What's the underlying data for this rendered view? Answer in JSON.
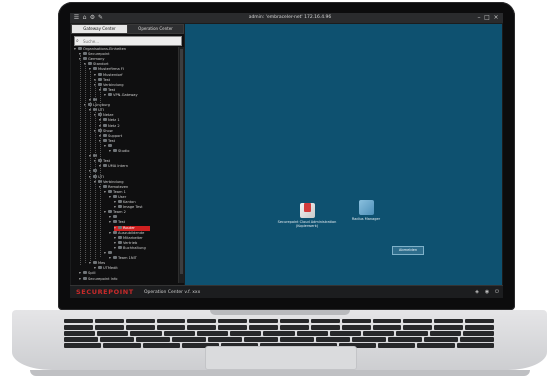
{
  "window": {
    "title": "admin: 'embraceler-net' 172.16.4.96"
  },
  "sidebar": {
    "tabs": [
      {
        "label": "Gateway Center",
        "active": true
      },
      {
        "label": "Operation Center",
        "active": false
      }
    ],
    "filter_placeholder": "Suche..."
  },
  "tree": [
    {
      "label": "Organisations-Einheiten",
      "depth": 0
    },
    {
      "label": "Securepoint",
      "depth": 1
    },
    {
      "label": "Germany",
      "depth": 1
    },
    {
      "label": "Standort",
      "depth": 2
    },
    {
      "label": "Musterfirma FI",
      "depth": 3
    },
    {
      "label": "Musterdorf",
      "depth": 4
    },
    {
      "label": "Test",
      "depth": 4
    },
    {
      "label": "Verbindung",
      "depth": 4
    },
    {
      "label": "Test",
      "depth": 5
    },
    {
      "label": "VPN-Gateway",
      "depth": 6
    },
    {
      "label": "",
      "depth": 3
    },
    {
      "label": "Lüneburg",
      "depth": 2
    },
    {
      "label": "UTI",
      "depth": 3
    },
    {
      "label": "Netze",
      "depth": 4
    },
    {
      "label": "Netz 1",
      "depth": 5
    },
    {
      "label": "Netz 2",
      "depth": 5
    },
    {
      "label": "Show",
      "depth": 4
    },
    {
      "label": "Support",
      "depth": 5
    },
    {
      "label": "Test",
      "depth": 5
    },
    {
      "label": "",
      "depth": 6
    },
    {
      "label": "Studio",
      "depth": 7
    },
    {
      "label": "",
      "depth": 3
    },
    {
      "label": "Test",
      "depth": 4
    },
    {
      "label": "UMA Intern",
      "depth": 5
    },
    {
      "label": "",
      "depth": 3
    },
    {
      "label": "UTI",
      "depth": 3
    },
    {
      "label": "Verbindung",
      "depth": 4
    },
    {
      "label": "Remotezen",
      "depth": 5
    },
    {
      "label": "Team 1",
      "depth": 6
    },
    {
      "label": "User",
      "depth": 7
    },
    {
      "label": "Kanton",
      "depth": 8
    },
    {
      "label": "Image Test",
      "depth": 8
    },
    {
      "label": "Team 2",
      "depth": 6
    },
    {
      "label": "",
      "depth": 7
    },
    {
      "label": "Test",
      "depth": 7
    },
    {
      "label": "Router",
      "depth": 8,
      "selected": true
    },
    {
      "label": "Auszubildende",
      "depth": 7
    },
    {
      "label": "Mitarbeiter",
      "depth": 8
    },
    {
      "label": "Vertrieb",
      "depth": 8
    },
    {
      "label": "Buchhaltung",
      "depth": 8
    },
    {
      "label": "",
      "depth": 6
    },
    {
      "label": "Team 1NIT",
      "depth": 7
    },
    {
      "label": "Mes",
      "depth": 3
    },
    {
      "label": "UTMedit",
      "depth": 4
    },
    {
      "label": "Spill",
      "depth": 1
    },
    {
      "label": "Securepoint Info",
      "depth": 1
    }
  ],
  "desktop": {
    "icons": [
      {
        "label": "Securepoint Cloud Administration (Kopierwerk)",
        "color": "#c9c9c9"
      },
      {
        "label": "Radius Manager",
        "color": "#4d8fb8"
      }
    ],
    "logout_label": "Abmelden"
  },
  "footer": {
    "brand": "SECUREPOINT",
    "subtitle": "Operation Center v.f. xxx"
  },
  "colors": {
    "desktop": "#0e5170",
    "brand": "#c82a2a",
    "selection": "#d02020"
  },
  "icons": [
    "app-menu-icon",
    "home-icon",
    "settings-icon",
    "pin-icon",
    "minimize-icon",
    "maximize-icon",
    "close-icon",
    "search-icon"
  ]
}
